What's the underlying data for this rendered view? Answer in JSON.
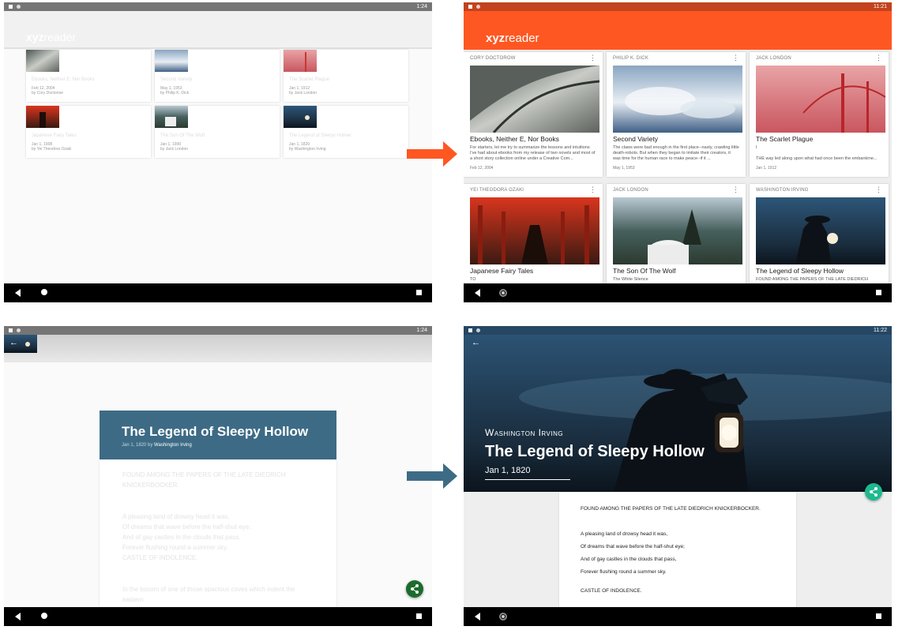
{
  "status_time_a": "1:24",
  "status_time_b": "11:21",
  "status_time_c": "1:24",
  "status_time_d": "11:22",
  "app_title_bold": "xyz",
  "app_title_rest": "reader",
  "colors": {
    "accent_orange": "#ff5722",
    "detail_blue": "#3d6b85",
    "share_green": "#1b6b2d",
    "share_teal": "#1db98f",
    "arrow_blue": "#3d6b85"
  },
  "list_before": [
    {
      "title": "Ebooks, Neither E, Nor Books",
      "date": "Feb 12, 2004",
      "byline": "by Cory Doctorow"
    },
    {
      "title": "Second Variety",
      "date": "May 1, 1953",
      "byline": "by Philip K. Dick"
    },
    {
      "title": "The Scarlet Plague",
      "date": "Jan 1, 1912",
      "byline": "by Jack London"
    },
    {
      "title": "Japanese Fairy Tales",
      "date": "Jan 1, 1908",
      "byline": "by Yei Theodora Ozaki"
    },
    {
      "title": "The Son Of The Wolf",
      "date": "Jan 1, 1900",
      "byline": "by Jack London"
    },
    {
      "title": "The Legend of Sleepy Hollow",
      "date": "Jan 1, 1820",
      "byline": "by Washington Irving"
    }
  ],
  "list_after": [
    {
      "author": "Cory Doctorow",
      "title": "Ebooks, Neither E, Nor Books",
      "body": "For starters, let me try to summarize the lessons and intuitions I've had about ebooks from my release of two novels and most of a short story collection online under a Creative Com...",
      "date": "Feb 12, 2004"
    },
    {
      "author": "Philip K. Dick",
      "title": "Second Variety",
      "body": "The claws were bad enough in the first place--nasty, crawling little death-robots. But when they began to imitate their creators, it was time for the human race to make peace--if it ...",
      "date": "May 1, 1953"
    },
    {
      "author": "Jack London",
      "title": "The Scarlet Plague",
      "body": "I\n\nTHE way led along upon what had once been the embankme...",
      "date": "Jan 1, 1912"
    },
    {
      "author": "Yei Theodora Ozaki",
      "title": "Japanese Fairy Tales",
      "body": "TO",
      "date": ""
    },
    {
      "author": "Jack London",
      "title": "The Son Of The Wolf",
      "body": "The White Silence",
      "date": ""
    },
    {
      "author": "Washington Irving",
      "title": "The Legend of Sleepy Hollow",
      "body": "FOUND AMONG THE PAPERS OF THE LATE DIEDRICH",
      "date": ""
    }
  ],
  "detail_before": {
    "title": "The Legend of Sleepy Hollow",
    "date": "Jan 1, 1820",
    "by": "by",
    "author": "Washington Irving",
    "lines": [
      "FOUND AMONG THE PAPERS OF THE LATE DIEDRICH",
      "KNICKERBOCKER.",
      "A pleasing land of drowsy head it was,",
      "Of dreams that wave before the half-shut eye;",
      "And of gay castles in the clouds that pass,",
      "Forever flushing round a summer sky.",
      "CASTLE OF INDOLENCE.",
      "In the bosom of one of those spacious coves which indent the",
      "eastern"
    ]
  },
  "detail_after": {
    "author": "Washington Irving",
    "title": "The Legend of Sleepy Hollow",
    "date": "Jan 1, 1820",
    "lines": [
      "FOUND AMONG THE PAPERS OF THE LATE DIEDRICH KNICKERBOCKER.",
      "A pleasing land of drowsy head it was,",
      "Of dreams that wave before the half-shut eye;",
      "And of gay castles in the clouds that pass,",
      "Forever flushing round a summer sky.",
      "CASTLE OF INDOLENCE."
    ]
  }
}
